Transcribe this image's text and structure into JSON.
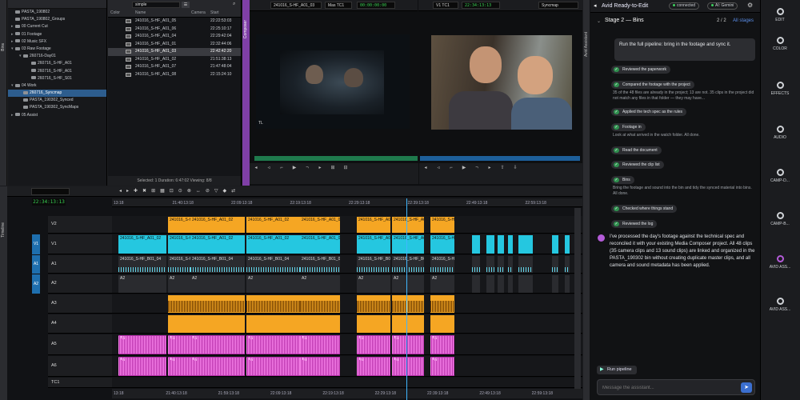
{
  "bin": {
    "strip_label": "Bins",
    "folders": [
      {
        "label": "PASTA_190802",
        "depth": 0,
        "tri": ""
      },
      {
        "label": "PASTA_190802_Groups",
        "depth": 0,
        "tri": ""
      },
      {
        "label": "00 Current Cut",
        "depth": 0,
        "tri": "▸"
      },
      {
        "label": "01 Footage",
        "depth": 0,
        "tri": "▸"
      },
      {
        "label": "02 Music SFX",
        "depth": 0,
        "tri": "▸"
      },
      {
        "label": "03 Raw Footage",
        "depth": 0,
        "tri": "▾"
      },
      {
        "label": "260716-Day01",
        "depth": 1,
        "tri": "▾"
      },
      {
        "label": "260716_S-HF_A01",
        "depth": 2,
        "tri": ""
      },
      {
        "label": "260716_S-HF_A01",
        "depth": 2,
        "tri": ""
      },
      {
        "label": "260716_S-HF_S01",
        "depth": 2,
        "tri": ""
      },
      {
        "label": "04 Work",
        "depth": 0,
        "tri": "▾"
      },
      {
        "label": "260716_Syncmap",
        "depth": 1,
        "tri": "",
        "selected": true
      },
      {
        "label": "PASTA_190302_Synced",
        "depth": 1,
        "tri": ""
      },
      {
        "label": "PASTA_190302_SyncMaps",
        "depth": 1,
        "tri": ""
      },
      {
        "label": "05 Assist",
        "depth": 0,
        "tri": "▸"
      }
    ],
    "view_select": "simple",
    "columns": {
      "color": "Color",
      "name": "Name",
      "camera": "Camera",
      "start": "Start"
    },
    "clips": [
      {
        "name": "241016_S-HF_A01_05",
        "start": "22:22:53:03"
      },
      {
        "name": "241016_S-HF_A01_06",
        "start": "22:25:10:17"
      },
      {
        "name": "241016_S-HF_A01_04",
        "start": "22:29:42:04"
      },
      {
        "name": "241016_S-HF_A01_01",
        "start": "22:32:44:06"
      },
      {
        "name": "241016_S-HF_A01_03",
        "start": "22:42:42:20",
        "selected": true
      },
      {
        "name": "241016_S-HF_A01_02",
        "start": "21:51:38:13"
      },
      {
        "name": "241016_S-HF_A01_07",
        "start": "21:47:48:04"
      },
      {
        "name": "241016_S-HF_A01_08",
        "start": "22:15:24:10"
      }
    ],
    "status": "Selected: 1  Duration: 6:47:02  Viewing: 8/8"
  },
  "composer": {
    "strip_label": "Composer",
    "source_tc": "241016_S-HF_A01_03",
    "source_label": "Mas  TC1",
    "source_time": "00:00:00:00",
    "record_label": "V1  TC1",
    "record_time": "22:34:13:13",
    "record_mode": "Syncmap",
    "track_marker": "TL"
  },
  "assistant": {
    "strip_label": "Avid Assistant",
    "title": "Avid Ready-to-Edit",
    "connected": "connected",
    "model": "AI: Gemini",
    "stage": "Stage 2 — Bins",
    "stage_progress": "2 / 2",
    "all_stages": "All stages",
    "user_message": "Run the full pipeline: bring in the footage and sync it.",
    "steps": [
      {
        "label": "Reviewed the paperwork",
        "note": ""
      },
      {
        "label": "Compared the footage with the project",
        "note": "35 of the 48 files are already in the project; 13 are not. 35 clips in the project did not match any files in that folder — they may have..."
      },
      {
        "label": "Applied the tech spec as the rules",
        "note": ""
      },
      {
        "label": "Footage in",
        "note": "Look at what arrived in the watch folder. All done."
      },
      {
        "label": "Read the document",
        "note": ""
      },
      {
        "label": "Reviewed the clip list",
        "note": ""
      },
      {
        "label": "Bins",
        "note": "Bring the footage and sound into the bin and tidy the synced material into bins. All done."
      },
      {
        "label": "Checked where things stand",
        "note": ""
      },
      {
        "label": "Reviewed the log",
        "note": ""
      }
    ],
    "final_message": "I've processed the day's footage against the technical spec and reconciled it with your existing Media Composer project. All 48 clips (35 camera clips and 13 sound clips) are linked and organized in the PASTA_190302 bin without creating duplicate master clips, and all camera and sound metadata has been applied.",
    "run_button": "Run pipeline",
    "input_placeholder": "Message the assistant..."
  },
  "rail": [
    {
      "label": "EDIT",
      "icon": "edit-icon"
    },
    {
      "label": "COLOR",
      "icon": "color-icon"
    },
    {
      "label": "EFFECTS",
      "icon": "effects-icon"
    },
    {
      "label": "AUDIO",
      "icon": "audio-icon"
    },
    {
      "label": "CAMP-D...",
      "icon": "camp-icon"
    },
    {
      "label": "CAMP-B...",
      "icon": "camp-icon"
    },
    {
      "label": "AVID ASS...",
      "icon": "assistant-icon",
      "active": true
    },
    {
      "label": "AVID ASS...",
      "icon": "assistant-icon"
    }
  ],
  "timeline": {
    "strip_label": "Timeline",
    "timecode": "22:34:13:13",
    "ruler_top": [
      "13:18",
      "21:40:13:18",
      "22:09:13:18",
      "22:19:13:18",
      "22:29:13:18",
      "22:39:13:18",
      "22:49:13:18",
      "22:59:13:18"
    ],
    "ruler_bottom": [
      "13:18",
      "21:40:13:18",
      "21:59:13:18",
      "22:09:13:18",
      "22:19:13:18",
      "22:29:13:18",
      "22:39:13:18",
      "22:49:13:18",
      "22:59:13:18"
    ],
    "tracks": [
      {
        "label": "V2",
        "src": ""
      },
      {
        "label": "V1",
        "src": "V1"
      },
      {
        "label": "A1",
        "src": "A1"
      },
      {
        "label": "A2",
        "src": "A2"
      },
      {
        "label": "A3",
        "src": ""
      },
      {
        "label": "A4",
        "src": ""
      },
      {
        "label": "A5",
        "src": ""
      },
      {
        "label": "A6",
        "src": ""
      },
      {
        "label": "TC1",
        "src": ""
      }
    ],
    "clip_name": "241016_S-HF_A01_02",
    "clip_short": "241016_S-HF_B01_04",
    "v1": "V1",
    "a1": "A1",
    "a2": "A2",
    "a5": "A5",
    "a6": "A6"
  }
}
